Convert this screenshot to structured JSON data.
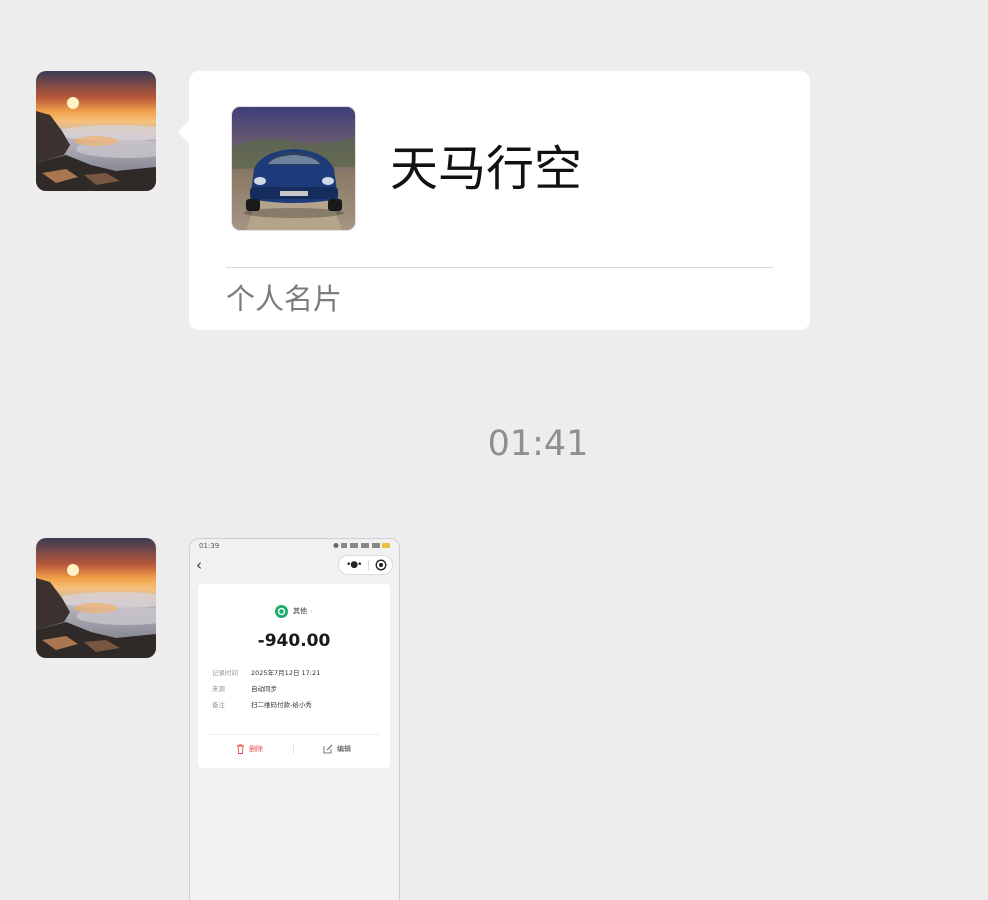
{
  "messages": [
    {
      "type": "contact-card",
      "card": {
        "name": "天马行空",
        "type_label": "个人名片"
      }
    },
    {
      "type": "image",
      "screenshot": {
        "status_time": "01:39",
        "record": {
          "category": "其他",
          "amount": "-940.00",
          "fields": [
            {
              "label": "记录时间",
              "value": "2025年7月12日 17:21"
            },
            {
              "label": "来源",
              "value": "自动同步"
            },
            {
              "label": "备注",
              "value": "扫二维码付款-给小秀"
            }
          ],
          "delete_label": "删除",
          "edit_label": "编辑"
        }
      }
    }
  ],
  "timestamp": "01:41",
  "colors": {
    "background": "#ededed",
    "bubble": "#ffffff",
    "timestamp_text": "#8f8f8f",
    "delete_red": "#e0524a",
    "category_green": "#1aad6b"
  },
  "icons": [
    "sunset-avatar-image",
    "car-photo",
    "back-chevron-icon",
    "more-dots-icon",
    "target-icon",
    "category-icon",
    "trash-icon",
    "edit-icon"
  ]
}
